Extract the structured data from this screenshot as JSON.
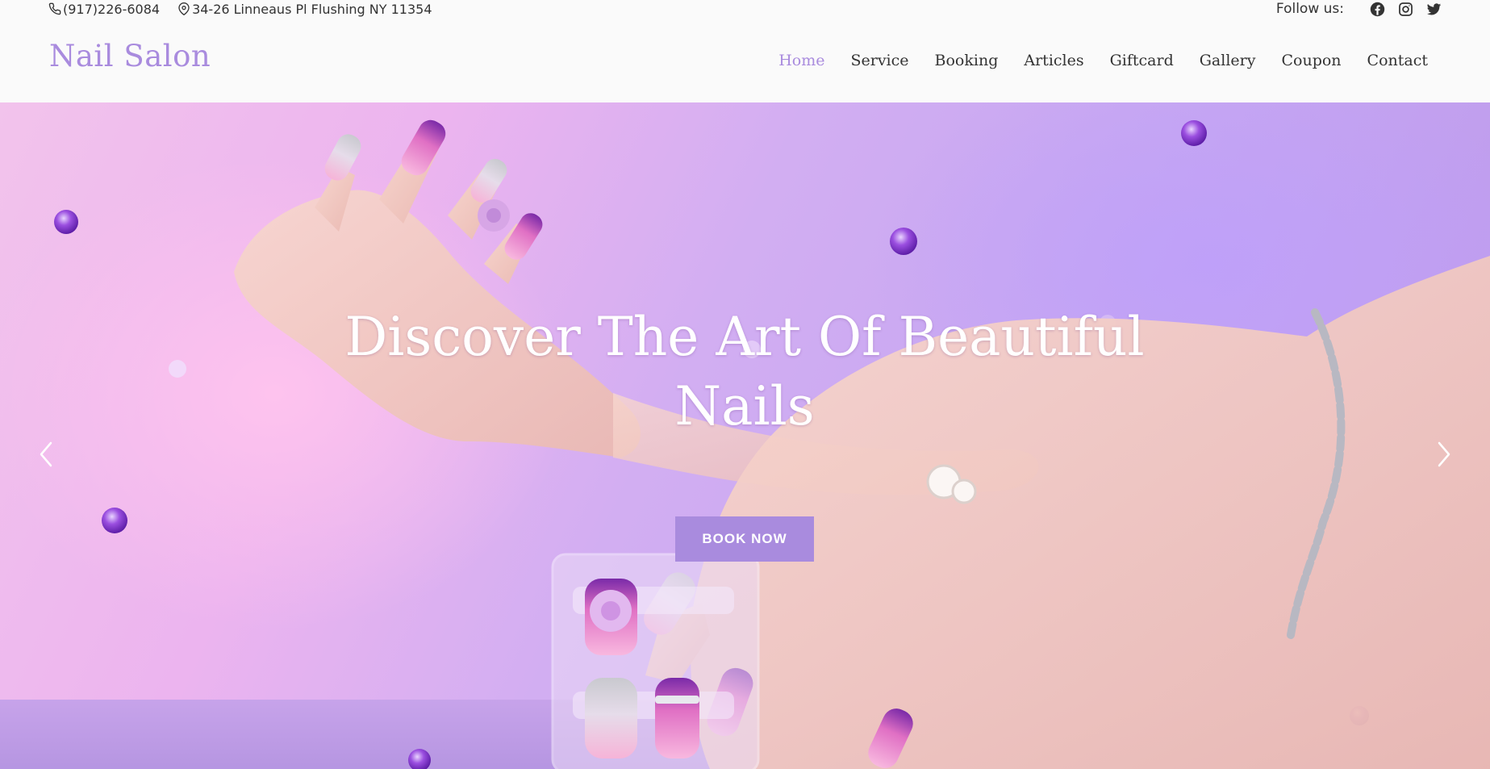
{
  "topbar": {
    "phone": "(917)226-6084",
    "address": "34-26 Linneaus Pl Flushing NY 11354",
    "follow_label": "Follow us:",
    "social_icons": [
      "facebook-icon",
      "instagram-icon",
      "twitter-icon"
    ]
  },
  "header": {
    "logo": "Nail Salon",
    "nav": [
      {
        "label": "Home",
        "active": true
      },
      {
        "label": "Service",
        "active": false
      },
      {
        "label": "Booking",
        "active": false
      },
      {
        "label": "Articles",
        "active": false
      },
      {
        "label": "Giftcard",
        "active": false
      },
      {
        "label": "Gallery",
        "active": false
      },
      {
        "label": "Coupon",
        "active": false
      },
      {
        "label": "Contact",
        "active": false
      }
    ]
  },
  "hero": {
    "title_line1": "Discover The Art Of Beautiful",
    "title_line2": "Nails",
    "button_label": "BOOK NOW",
    "prev_icon": "chevron-left-icon",
    "next_icon": "chevron-right-icon"
  },
  "colors": {
    "accent": "#a98bde",
    "text": "#333333",
    "background": "#fafafa"
  }
}
